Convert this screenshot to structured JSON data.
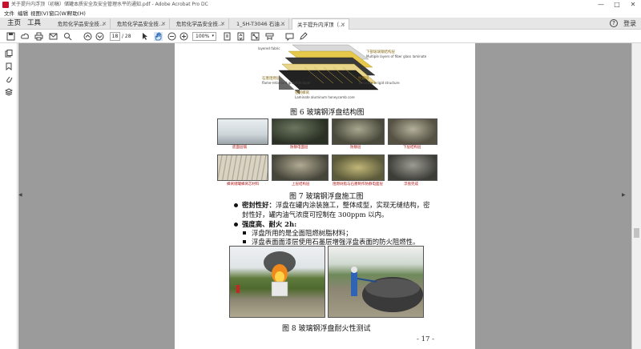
{
  "window": {
    "title": "关于提升内浮顶（初稿）储罐本质安全及安全管理水平的通知.pdf - Adobe Acrobat Pro DC",
    "controls": [
      "—",
      "□",
      "✕"
    ]
  },
  "menu": [
    "文件",
    "编辑",
    "视图(V)",
    "窗口(W)",
    "帮助(H)"
  ],
  "tabbar": {
    "home": "主页",
    "tools": "工具",
    "doc_tabs": [
      {
        "label": "危险化学品安全技…",
        "active": false
      },
      {
        "label": "危险化学品安全技…",
        "active": false
      },
      {
        "label": "危险化学品安全技…",
        "active": false
      },
      {
        "label": "1_SH-T3046 石油…",
        "active": false
      },
      {
        "label": "关于提升内浮顶（…",
        "active": true
      }
    ],
    "help": "?",
    "signin": "登录"
  },
  "toolbar": {
    "page_current": "18",
    "page_total": "/ 28",
    "zoom": "100%"
  },
  "document": {
    "structure_labels": {
      "top_left_en": "layered fabric",
      "top_right_cn": "下部玻璃钢结构层",
      "top_right_en": "Multiple layers of fiber glass laminate",
      "mid_left_cn": "石墨阻燃层",
      "mid_left_en": "flame-retardant graphite layer",
      "mid_right_cn": "抗震层",
      "mid_right_en": "To create a rigid structure",
      "bottom_cn": "铝制蜂窝",
      "bottom_en": "Laminate aluminum honeycomb core"
    },
    "fig6_caption": "图 6   玻璃钢浮盘结构图",
    "photos": [
      {
        "label": "底面层铺"
      },
      {
        "label": "防静电面层"
      },
      {
        "label": "防静层"
      },
      {
        "label": "下层结构层"
      },
      {
        "label": "蜂窝储罐蜂窝芯材料"
      },
      {
        "label": "上层结构层"
      },
      {
        "label": "阻燃树脂与石墨制作防静电面层"
      },
      {
        "label": "浮盘完成"
      }
    ],
    "fig7_caption": "图 7   玻璃钢浮盘施工图",
    "bullet1_label": "密封性好：",
    "bullet1_line1": "浮盘在罐内涂装施工，整体成型，实现无缝结构，密",
    "bullet1_line2": "封性好，罐内油气浓度可控制在 300ppm 以内。",
    "bullet2_label": "强度高、耐火 2h:",
    "sub1": "浮盘所用的是全面阻燃树脂材料；",
    "sub2": "浮盘表面面漆层使用石墨层增强浮盘表面的防火阻燃性。",
    "fig8_caption": "图 8   玻璃钢浮盘耐火性测试",
    "page_number": "- 17 -"
  }
}
